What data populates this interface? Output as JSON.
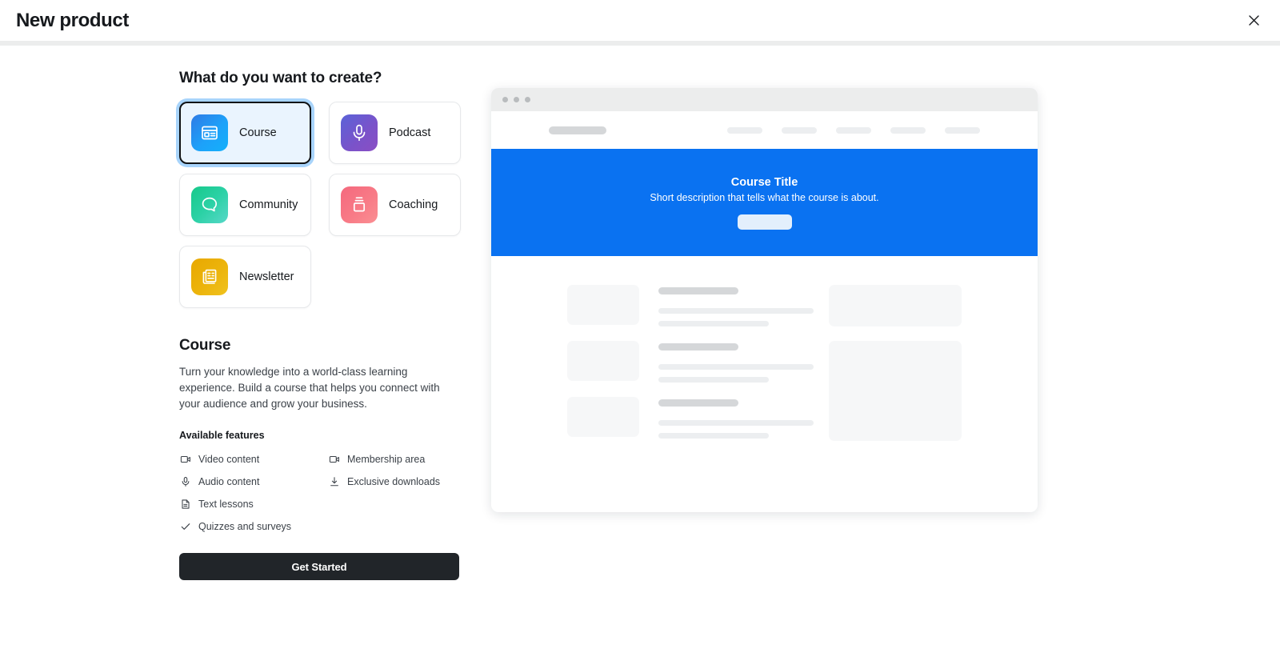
{
  "header": {
    "title": "New product",
    "close_label": "Close"
  },
  "left": {
    "section_heading": "What do you want to create?",
    "types": [
      {
        "label": "Course",
        "icon": "course-window-icon",
        "selected": true
      },
      {
        "label": "Podcast",
        "icon": "microphone-icon",
        "selected": false
      },
      {
        "label": "Community",
        "icon": "chat-bubble-icon",
        "selected": false
      },
      {
        "label": "Coaching",
        "icon": "presentation-icon",
        "selected": false
      },
      {
        "label": "Newsletter",
        "icon": "newspaper-icon",
        "selected": false
      }
    ],
    "detail": {
      "title": "Course",
      "description": "Turn your knowledge into a world-class learning experience. Build a course that helps you connect with your audience and grow your business.",
      "features_title": "Available features",
      "features": [
        {
          "label": "Video content",
          "icon": "video-camera-icon"
        },
        {
          "label": "Membership area",
          "icon": "video-camera-icon"
        },
        {
          "label": "Audio content",
          "icon": "microphone-icon"
        },
        {
          "label": "Exclusive downloads",
          "icon": "download-icon"
        },
        {
          "label": "Text lessons",
          "icon": "document-icon"
        },
        {
          "label": "",
          "icon": ""
        },
        {
          "label": "Quizzes and surveys",
          "icon": "check-icon"
        },
        {
          "label": "",
          "icon": ""
        }
      ]
    },
    "cta_label": "Get Started"
  },
  "preview": {
    "hero": {
      "title": "Course Title",
      "subtitle": "Short description that tells what the course is about."
    }
  },
  "colors": {
    "accent_blue": "#0a72f1",
    "selected_card_bg": "#eaf4fe",
    "focus_ring": "#a8d4fb",
    "cta_bg": "#212529",
    "separator": "#eceded"
  }
}
